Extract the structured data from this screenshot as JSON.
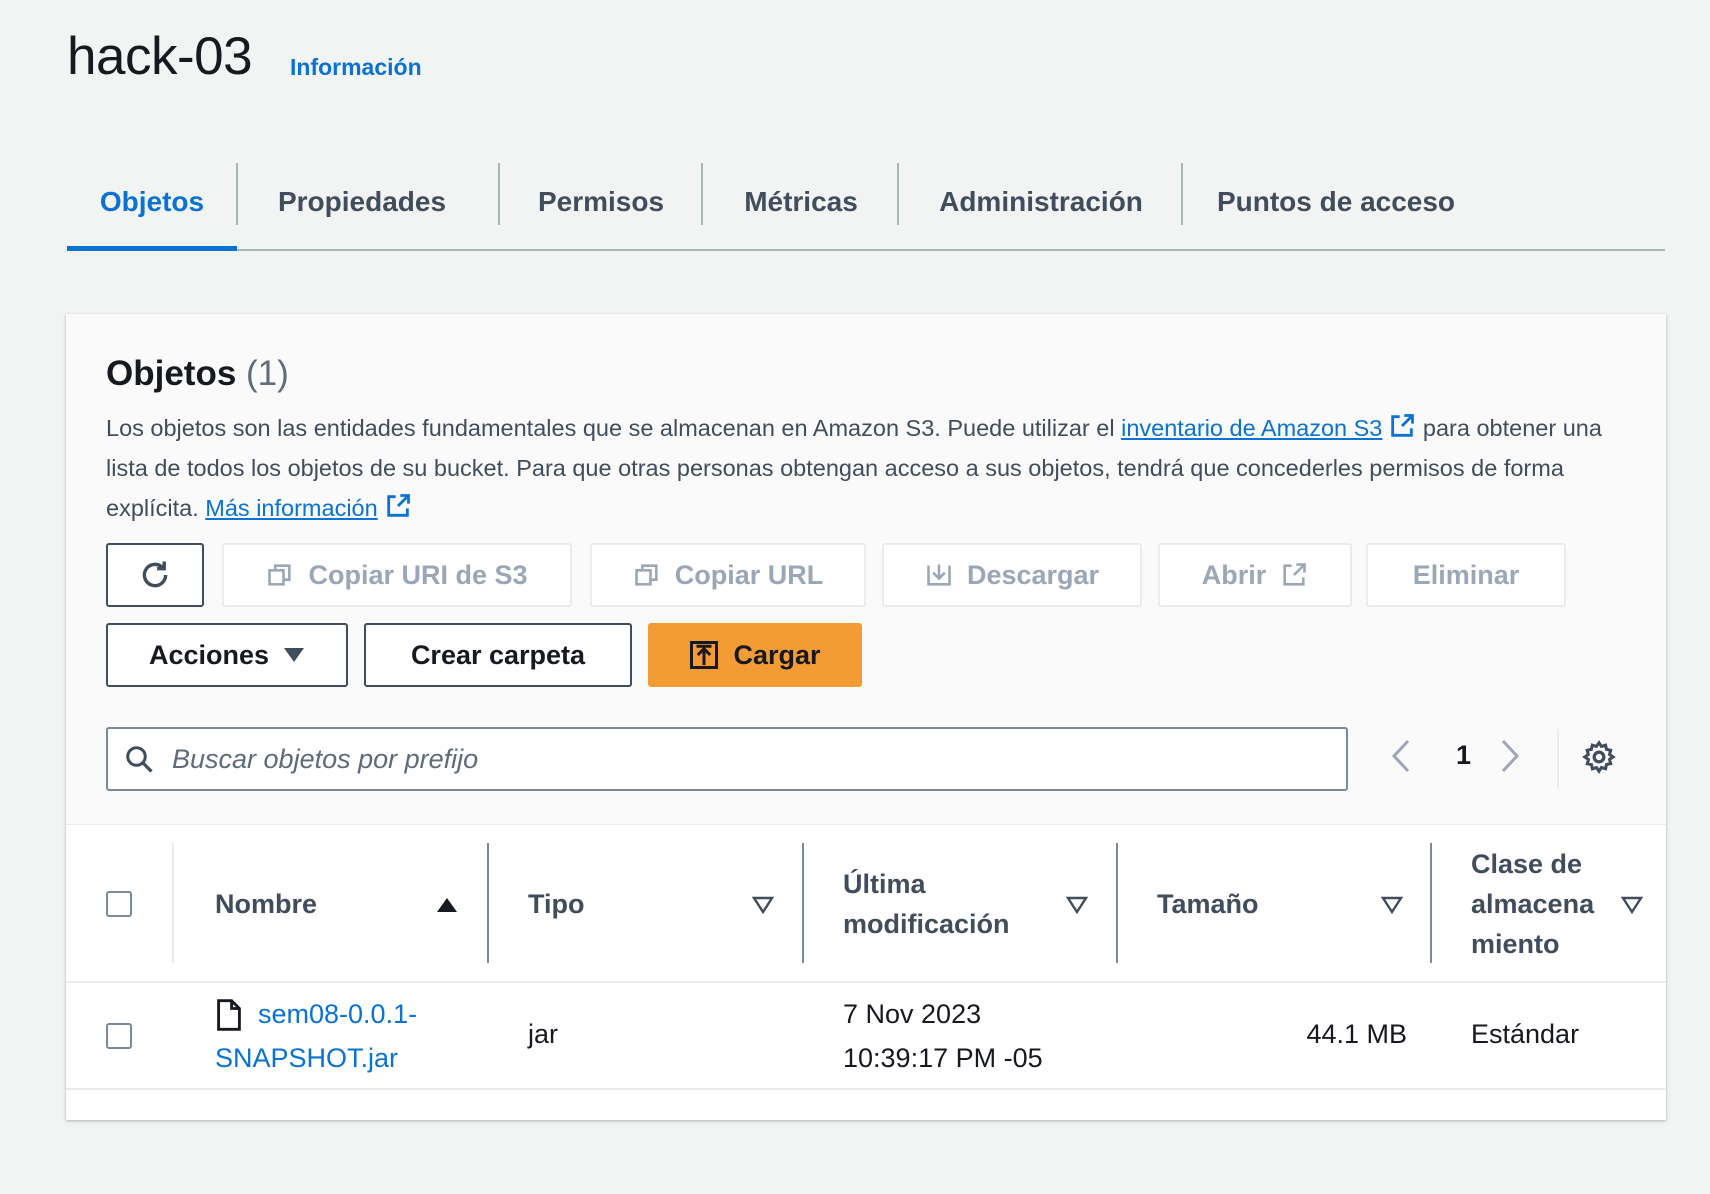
{
  "header": {
    "title": "hack-03",
    "info_link": "Información"
  },
  "tabs": [
    {
      "label": "Objetos",
      "active": true
    },
    {
      "label": "Propiedades"
    },
    {
      "label": "Permisos"
    },
    {
      "label": "Métricas"
    },
    {
      "label": "Administración"
    },
    {
      "label": "Puntos de acceso"
    }
  ],
  "objects_panel": {
    "heading": "Objetos",
    "count": "(1)",
    "description": {
      "part1": "Los objetos son las entidades fundamentales que se almacenan en Amazon S3. Puede utilizar el ",
      "link1": "inventario de Amazon S3",
      "part2": " para obtener una lista de todos los objetos de su bucket. Para que otras personas obtengan acceso a sus objetos, tendrá que concederles permisos de forma explícita. ",
      "link2": "Más información"
    },
    "toolbar": {
      "refresh_icon": "refresh-icon",
      "copy_uri": "Copiar URI de S3",
      "copy_url": "Copiar URL",
      "download": "Descargar",
      "open": "Abrir",
      "delete": "Eliminar",
      "actions": "Acciones",
      "create_folder": "Crear carpeta",
      "upload": "Cargar"
    },
    "search": {
      "placeholder": "Buscar objetos por prefijo",
      "value": ""
    },
    "pagination": {
      "current_page": "1"
    },
    "table": {
      "columns": {
        "name": "Nombre",
        "type": "Tipo",
        "modified_line1": "Última",
        "modified_line2": "modificación",
        "size": "Tamaño",
        "storage_line1": "Clase de",
        "storage_line2": "almacena",
        "storage_line3": "miento"
      },
      "rows": [
        {
          "name_line1": "sem08-0.0.1-",
          "name_line2": "SNAPSHOT.jar",
          "type": "jar",
          "modified_line1": "7 Nov 2023",
          "modified_line2": "10:39:17 PM -05",
          "size": "44.1 MB",
          "storage_class": "Estándar"
        }
      ]
    }
  },
  "colors": {
    "accent": "#0972d3",
    "primary_button": "#f39c35",
    "page_bg": "#f2f3f3"
  }
}
